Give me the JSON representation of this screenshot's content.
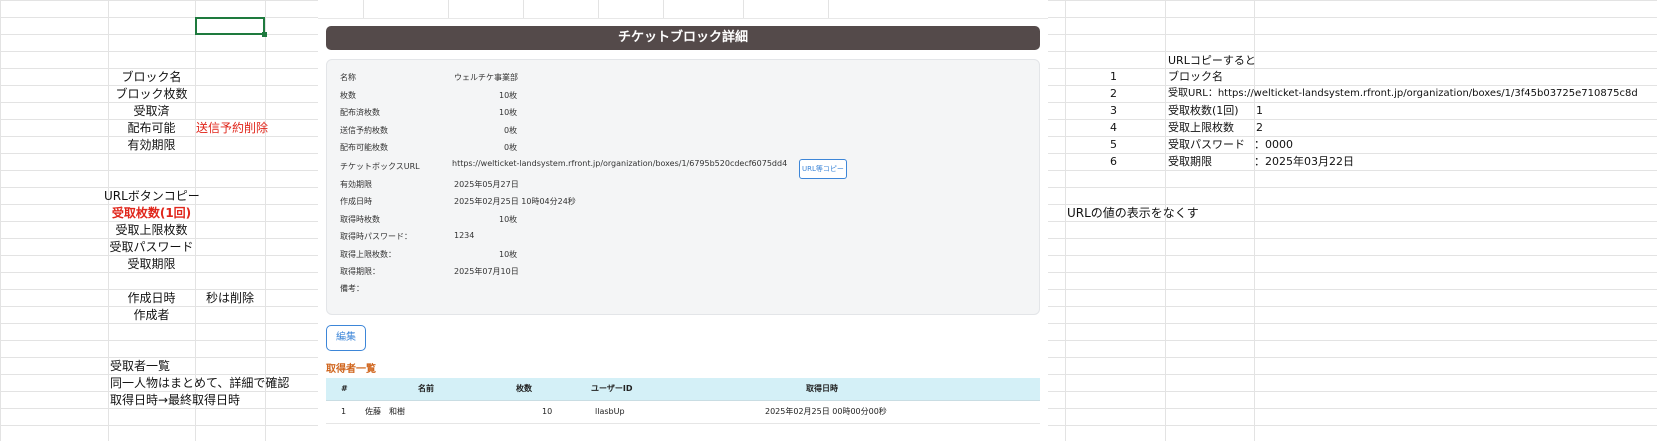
{
  "left_sheet": {
    "labels": [
      "ブロック名",
      "ブロック枚数",
      "受取済",
      "配布可能",
      "有効期限"
    ],
    "haifu_note": "送信予約削除",
    "url_labels": [
      "URLボタンコピー",
      "受取枚数(1回)",
      "受取上限枚数",
      "受取パスワード",
      "受取期限"
    ],
    "created_label": "作成日時",
    "created_note": "秒は削除",
    "author_label": "作成者",
    "recipients_title": "受取者一覧",
    "recipients_note1": "同一人物はまとめて、詳細で確認",
    "recipients_note2": "取得日時→最終取得日時"
  },
  "detail": {
    "title": "チケットブロック詳細",
    "fields": [
      {
        "label": "名称",
        "value": "ウェルチケ事業部"
      },
      {
        "label": "枚数",
        "value": "10枚"
      },
      {
        "label": "配布済枚数",
        "value": "10枚"
      },
      {
        "label": "送信予約枚数",
        "value": "0枚"
      },
      {
        "label": "配布可能枚数",
        "value": "0枚"
      },
      {
        "label": "チケットボックスURL",
        "value": "https://welticket-landsystem.rfront.jp/organization/boxes/1/6795b520cdecf6075dd4"
      },
      {
        "label": "有効期限",
        "value": "2025年05月27日"
      },
      {
        "label": "作成日時",
        "value": "2025年02月25日 10時04分24秒"
      },
      {
        "label": "取得時枚数",
        "value": "10枚"
      },
      {
        "label": "取得時パスワード：",
        "value": "1234"
      },
      {
        "label": "取得上限枚数：",
        "value": "10枚"
      },
      {
        "label": "取得期限：",
        "value": "2025年07月10日"
      },
      {
        "label": "備考：",
        "value": ""
      }
    ],
    "url_copy_button": "URL等コピー",
    "edit_button": "編集",
    "recipients_title": "取得者一覧",
    "table": {
      "headers": [
        "#",
        "名前",
        "枚数",
        "ユーザーID",
        "取得日時"
      ],
      "rows": [
        {
          "no": "1",
          "name": "佐藤　和樹",
          "count": "10",
          "user_id": "llasbUp",
          "date": "2025年02月25日 00時00分00秒"
        }
      ]
    }
  },
  "right_sheet": {
    "heading": "URLコピーすると",
    "items": [
      {
        "no": "1",
        "label": "ブロック名",
        "value": ""
      },
      {
        "no": "2",
        "label": "受取URL：https://welticket-landsystem.rfront.jp/organization/boxes/1/3f45b03725e710875c8d",
        "value": ""
      },
      {
        "no": "3",
        "label": "受取枚数(1回)",
        "value": "1"
      },
      {
        "no": "4",
        "label": "受取上限枚数",
        "value": "2"
      },
      {
        "no": "5",
        "label": "受取パスワード",
        "value": "：0000"
      },
      {
        "no": "6",
        "label": "受取期限",
        "value": "：2025年03月22日"
      }
    ],
    "note": "URLの値の表示をなくす"
  },
  "colors": {
    "red": "#e0261b",
    "title_bar": "#544a4a",
    "accent": "#3d86d8",
    "section": "#d0661f",
    "table_head": "#d4f0f7"
  }
}
